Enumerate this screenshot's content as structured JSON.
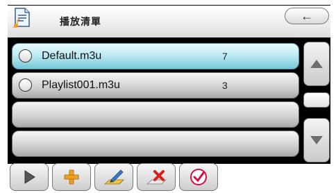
{
  "header": {
    "title": "播放清單",
    "app_icon": "playlist-document-icon",
    "back_icon": "arrow-left-icon",
    "back_glyph": "←"
  },
  "playlist": {
    "items": [
      {
        "name": "Default.m3u",
        "count": "7",
        "selected": true
      },
      {
        "name": "Playlist001.m3u",
        "count": "3",
        "selected": false
      },
      {
        "name": "",
        "count": "",
        "selected": false
      },
      {
        "name": "",
        "count": "",
        "selected": false
      }
    ]
  },
  "scrollbar": {
    "up_icon": "triangle-up-icon",
    "down_icon": "triangle-down-icon"
  },
  "toolbar": {
    "buttons": [
      {
        "icon": "play-icon"
      },
      {
        "icon": "plus-icon"
      },
      {
        "icon": "edit-pencil-icon"
      },
      {
        "icon": "delete-x-icon"
      },
      {
        "icon": "check-circle-icon"
      }
    ]
  },
  "colors": {
    "selected_row": "#bfeaf2",
    "plus": "#f0a020",
    "delete": "#d81e1e",
    "check": "#d01040"
  }
}
